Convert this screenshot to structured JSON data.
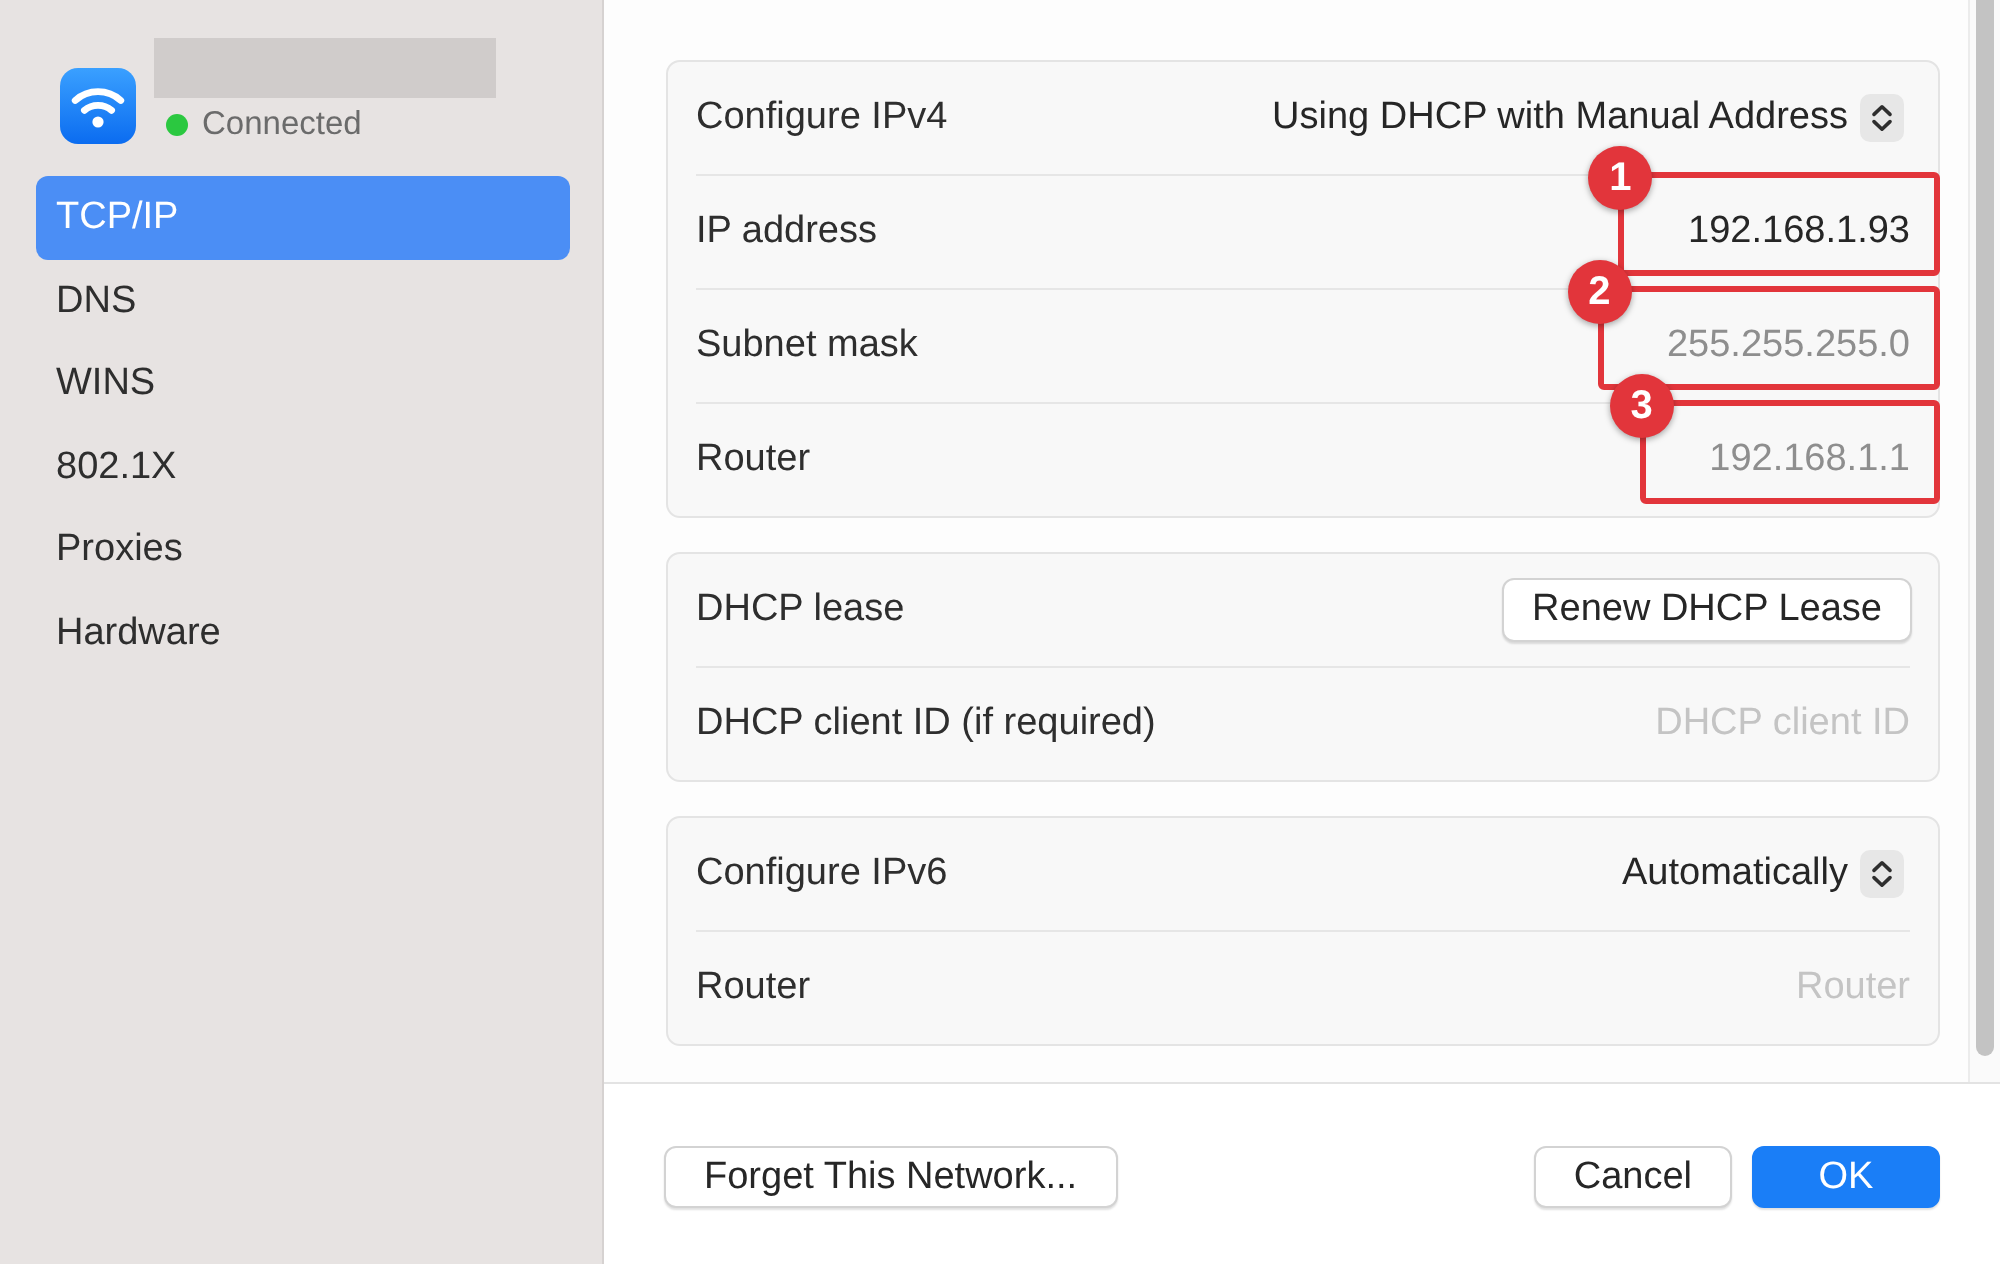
{
  "sidebar": {
    "network": {
      "status": "Connected",
      "connected": true
    },
    "items": [
      {
        "label": "TCP/IP",
        "selected": true
      },
      {
        "label": "DNS",
        "selected": false
      },
      {
        "label": "WINS",
        "selected": false
      },
      {
        "label": "802.1X",
        "selected": false
      },
      {
        "label": "Proxies",
        "selected": false
      },
      {
        "label": "Hardware",
        "selected": false
      }
    ]
  },
  "sections": [
    {
      "rows": [
        {
          "kind": "popup",
          "label": "Configure IPv4",
          "value": "Using DHCP with Manual Address"
        },
        {
          "kind": "field",
          "label": "IP address",
          "value": "192.168.1.93",
          "disabled": false,
          "annotation": "1"
        },
        {
          "kind": "field",
          "label": "Subnet mask",
          "value": "255.255.255.0",
          "disabled": true,
          "annotation": "2"
        },
        {
          "kind": "field",
          "label": "Router",
          "value": "192.168.1.1",
          "disabled": true,
          "annotation": "3"
        }
      ]
    },
    {
      "rows": [
        {
          "kind": "button",
          "label": "DHCP lease",
          "button": "Renew DHCP Lease"
        },
        {
          "kind": "field",
          "label": "DHCP client ID (if required)",
          "placeholder": "DHCP client ID"
        }
      ]
    },
    {
      "rows": [
        {
          "kind": "popup",
          "label": "Configure IPv6",
          "value": "Automatically"
        },
        {
          "kind": "field",
          "label": "Router",
          "placeholder": "Router"
        }
      ]
    }
  ],
  "footer": {
    "left": [
      {
        "label": "Forget This Network...",
        "default": false
      }
    ],
    "right": [
      {
        "label": "Cancel",
        "default": false
      },
      {
        "label": "OK",
        "default": true
      }
    ]
  }
}
